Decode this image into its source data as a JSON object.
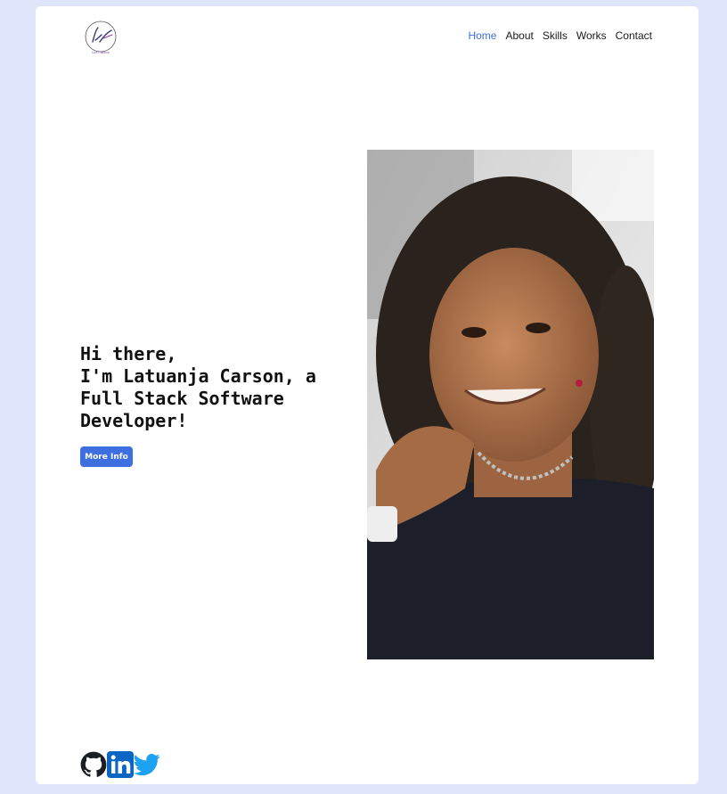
{
  "logo": {
    "monogram_icon": "lc-signature-logo",
    "caption": "Lat Carson"
  },
  "nav": {
    "items": [
      {
        "label": "Home",
        "active": true
      },
      {
        "label": "About",
        "active": false
      },
      {
        "label": "Skills",
        "active": false
      },
      {
        "label": "Works",
        "active": false
      },
      {
        "label": "Contact",
        "active": false
      }
    ]
  },
  "hero": {
    "lines": [
      "Hi there,",
      "I'm Latuanja Carson, a",
      "Full Stack Software",
      "Developer!"
    ],
    "button_label": "More Info"
  },
  "photo": {
    "subject": "portrait-photo"
  },
  "social": {
    "icons": [
      "github-icon",
      "linkedin-icon",
      "twitter-icon"
    ]
  },
  "colors": {
    "accent": "#3d6fe0",
    "background": "#dfe6fb",
    "twitter": "#1da1f2",
    "linkedin": "#0a66c2"
  }
}
